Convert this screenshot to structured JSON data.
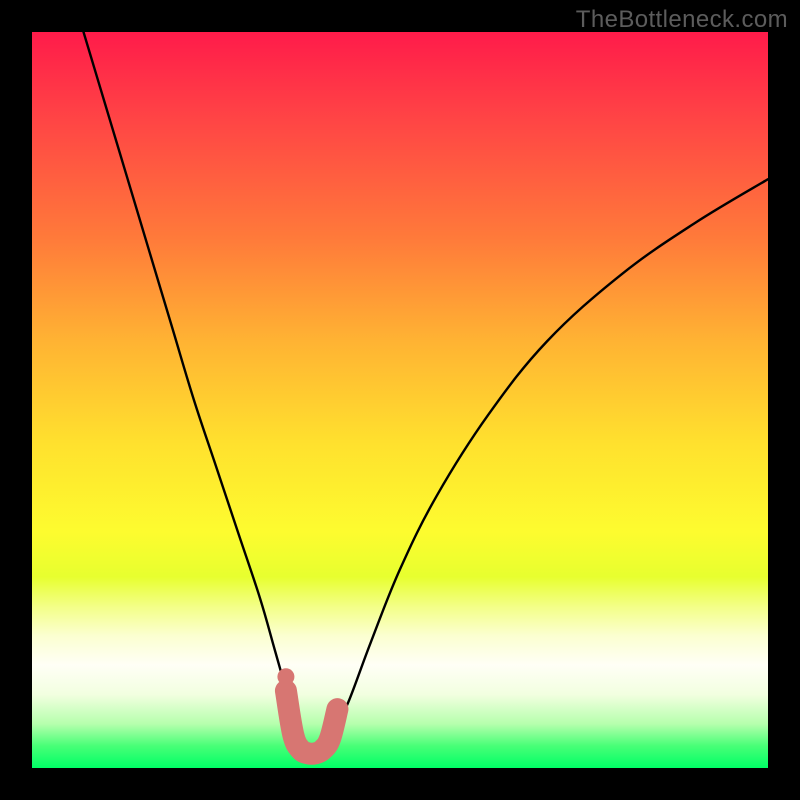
{
  "watermark": "TheBottleneck.com",
  "chart_data": {
    "type": "line",
    "title": "",
    "xlabel": "",
    "ylabel": "",
    "xlim": [
      0,
      100
    ],
    "ylim": [
      0,
      100
    ],
    "grid": false,
    "legend": false,
    "series": [
      {
        "name": "bottleneck-curve",
        "x": [
          7,
          10,
          13,
          16,
          19,
          22,
          25,
          28,
          31,
          33,
          35,
          36,
          37,
          38,
          39,
          40,
          41,
          43,
          46,
          50,
          55,
          62,
          70,
          80,
          90,
          100
        ],
        "values": [
          100,
          90,
          80,
          70,
          60,
          50,
          41,
          32,
          23,
          16,
          9,
          6,
          3,
          2,
          2,
          3,
          5,
          9,
          17,
          27,
          37,
          48,
          58,
          67,
          74,
          80
        ]
      },
      {
        "name": "highlight-band",
        "x": [
          34.5,
          35.5,
          36.5,
          37.5,
          38.5,
          39.5,
          40.5,
          41.5
        ],
        "values": [
          10.5,
          4.5,
          2.5,
          2.0,
          2.0,
          2.5,
          4.0,
          8.0
        ]
      }
    ],
    "highlight_color": "#d77672",
    "curve_color": "#000000"
  }
}
